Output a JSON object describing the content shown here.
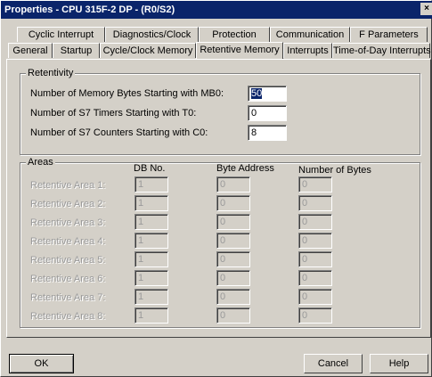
{
  "window": {
    "title": "Properties - CPU 315F-2 DP - (R0/S2)",
    "close_label": "×"
  },
  "tabs": {
    "row_back": [
      {
        "label": "Cyclic Interrupt"
      },
      {
        "label": "Diagnostics/Clock"
      },
      {
        "label": "Protection"
      },
      {
        "label": "Communication"
      },
      {
        "label": "F Parameters"
      }
    ],
    "row_front": [
      {
        "label": "General"
      },
      {
        "label": "Startup"
      },
      {
        "label": "Cycle/Clock Memory"
      },
      {
        "label": "Retentive Memory"
      },
      {
        "label": "Interrupts"
      },
      {
        "label": "Time-of-Day Interrupts"
      }
    ],
    "active": "Retentive Memory"
  },
  "retentivity": {
    "title": "Retentivity",
    "memory_bytes": {
      "label": "Number of Memory Bytes Starting with MB0:",
      "value": "50"
    },
    "timers": {
      "label": "Number of S7 Timers Starting with T0:",
      "value": "0"
    },
    "counters": {
      "label": "Number of S7 Counters Starting with C0:",
      "value": "8"
    }
  },
  "areas": {
    "title": "Areas",
    "headers": {
      "db_no": "DB No.",
      "byte_address": "Byte Address",
      "num_bytes": "Number of Bytes"
    },
    "rows": [
      {
        "label": "Retentive Area 1:",
        "db": "1",
        "addr": "0",
        "bytes": "0"
      },
      {
        "label": "Retentive Area 2:",
        "db": "1",
        "addr": "0",
        "bytes": "0"
      },
      {
        "label": "Retentive Area 3:",
        "db": "1",
        "addr": "0",
        "bytes": "0"
      },
      {
        "label": "Retentive Area 4:",
        "db": "1",
        "addr": "0",
        "bytes": "0"
      },
      {
        "label": "Retentive Area 5:",
        "db": "1",
        "addr": "0",
        "bytes": "0"
      },
      {
        "label": "Retentive Area 6:",
        "db": "1",
        "addr": "0",
        "bytes": "0"
      },
      {
        "label": "Retentive Area 7:",
        "db": "1",
        "addr": "0",
        "bytes": "0"
      },
      {
        "label": "Retentive Area 8:",
        "db": "1",
        "addr": "0",
        "bytes": "0"
      }
    ]
  },
  "buttons": {
    "ok": "OK",
    "cancel": "Cancel",
    "help": "Help"
  }
}
